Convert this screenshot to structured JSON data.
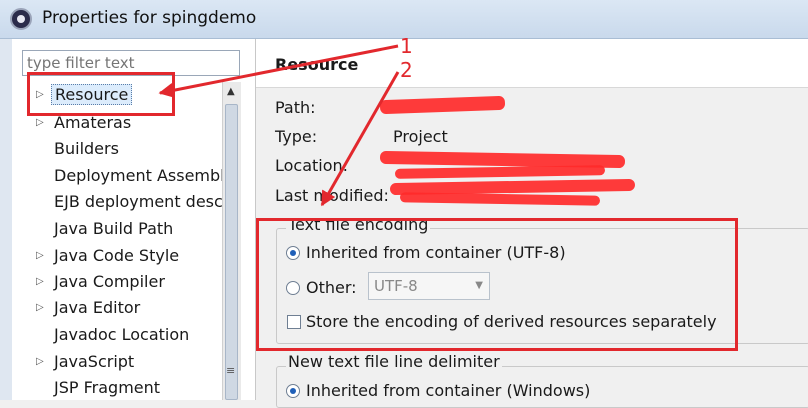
{
  "window": {
    "title": "Properties for spingdemo",
    "icon": "eclipse-icon"
  },
  "filter": {
    "placeholder": "type filter text"
  },
  "tree": {
    "items": [
      {
        "label": "Resource",
        "expandable": true,
        "selected": true
      },
      {
        "label": "Amateras",
        "expandable": true
      },
      {
        "label": "Builders",
        "expandable": false
      },
      {
        "label": "Deployment Assembly",
        "expandable": false
      },
      {
        "label": "EJB deployment desc",
        "expandable": false
      },
      {
        "label": "Java Build Path",
        "expandable": false
      },
      {
        "label": "Java Code Style",
        "expandable": true
      },
      {
        "label": "Java Compiler",
        "expandable": true
      },
      {
        "label": "Java Editor",
        "expandable": true
      },
      {
        "label": "Javadoc Location",
        "expandable": false
      },
      {
        "label": "JavaScript",
        "expandable": true
      },
      {
        "label": "JSP Fragment",
        "expandable": false
      }
    ]
  },
  "page": {
    "title": "Resource",
    "info": {
      "path_label": "Path:",
      "type_label": "Type:",
      "type_value": "Project",
      "location_label": "Location:",
      "modified_label": "Last modified:"
    },
    "encoding": {
      "title": "Text file encoding",
      "inherited_label": "Inherited from container (UTF-8)",
      "other_label": "Other:",
      "other_value": "UTF-8",
      "store_label": "Store the encoding of derived resources separately"
    },
    "delimiter": {
      "title": "New text file line delimiter",
      "inherited_label": "Inherited from container (Windows)"
    }
  },
  "annotations": {
    "num1": "1",
    "num2": "2",
    "color": "#e2282d"
  }
}
